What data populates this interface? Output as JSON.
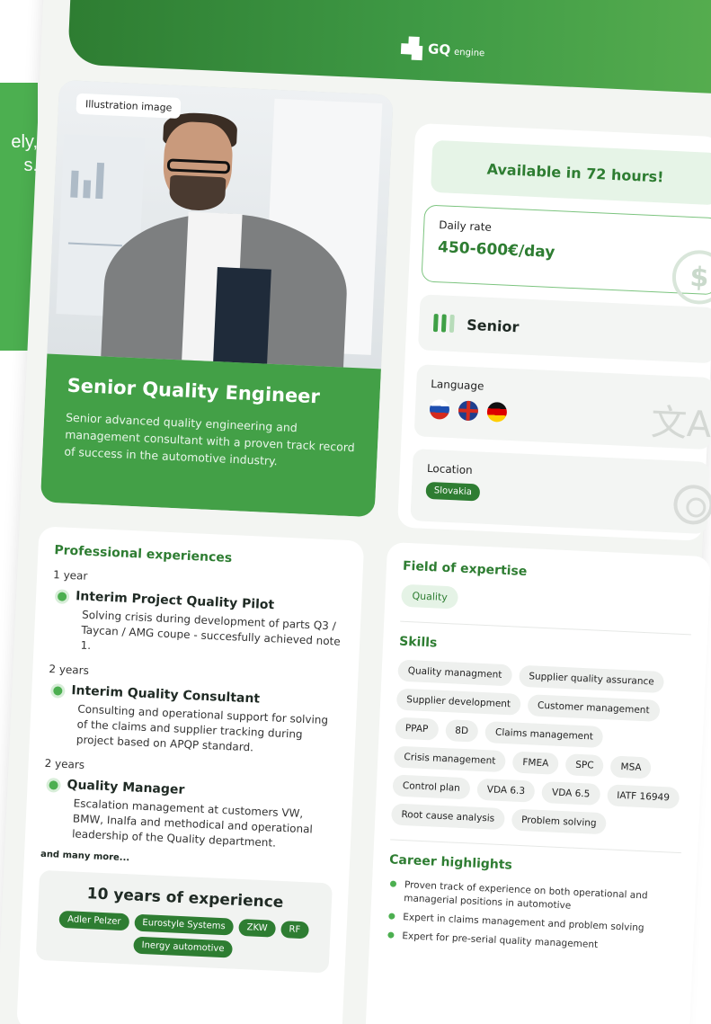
{
  "background": {
    "text_lines": [
      "ely,",
      "s."
    ]
  },
  "header": {
    "logo_text": "GQ",
    "logo_sub": "engine"
  },
  "hero": {
    "illustration_badge": "Illustration image",
    "title": "Senior Quality Engineer",
    "description": "Senior advanced quality engineering and management consultant with a proven track record of success in the automotive industry."
  },
  "availability": "Available in 72 hours!",
  "rate": {
    "label": "Daily rate",
    "value": "450-600€/day"
  },
  "seniority": "Senior",
  "language": {
    "label": "Language",
    "flags": [
      "slovakia-flag",
      "uk-flag",
      "germany-flag"
    ]
  },
  "location": {
    "label": "Location",
    "value": "Slovakia"
  },
  "experience": {
    "title": "Professional experiences",
    "jobs": [
      {
        "duration": "1 year",
        "title": "Interim Project Quality Pilot",
        "desc": "Solving crisis during development of parts Q3 / Taycan / AMG coupe  - succesfully achieved note 1."
      },
      {
        "duration": "2 years",
        "title": "Interim Quality Consultant",
        "desc": "Consulting and operational support for solving of the claims and supplier tracking during project based on APQP standard."
      },
      {
        "duration": "2 years",
        "title": "Quality Manager",
        "desc": "Escalation management at customers VW, BMW, Inalfa and methodical and operational leadership of the Quality department."
      }
    ],
    "more": "and many more...",
    "years_title": "10 years of experience",
    "companies": [
      "Adler Pelzer",
      "Eurostyle Systems",
      "ZKW",
      "RF",
      "Inergy automotive"
    ]
  },
  "expertise": {
    "title": "Field of expertise",
    "field": "Quality",
    "skills_title": "Skills",
    "skills": [
      "Quality managment",
      "Supplier quality assurance",
      "Supplier development",
      "Customer management",
      "PPAP",
      "8D",
      "Claims management",
      "Crisis management",
      "FMEA",
      "SPC",
      "MSA",
      "Control plan",
      "VDA 6.3",
      "VDA 6.5",
      "IATF 16949",
      "Root cause analysis",
      "Problem solving"
    ],
    "highlights_title": "Career highlights",
    "highlights": [
      "Proven track of experience on both operational and managerial positions in automotive",
      "Expert in claims management and problem solving",
      "Expert for pre-serial quality management"
    ]
  },
  "colors": {
    "brand_green": "#2e7d32",
    "accent_green": "#43a047"
  }
}
